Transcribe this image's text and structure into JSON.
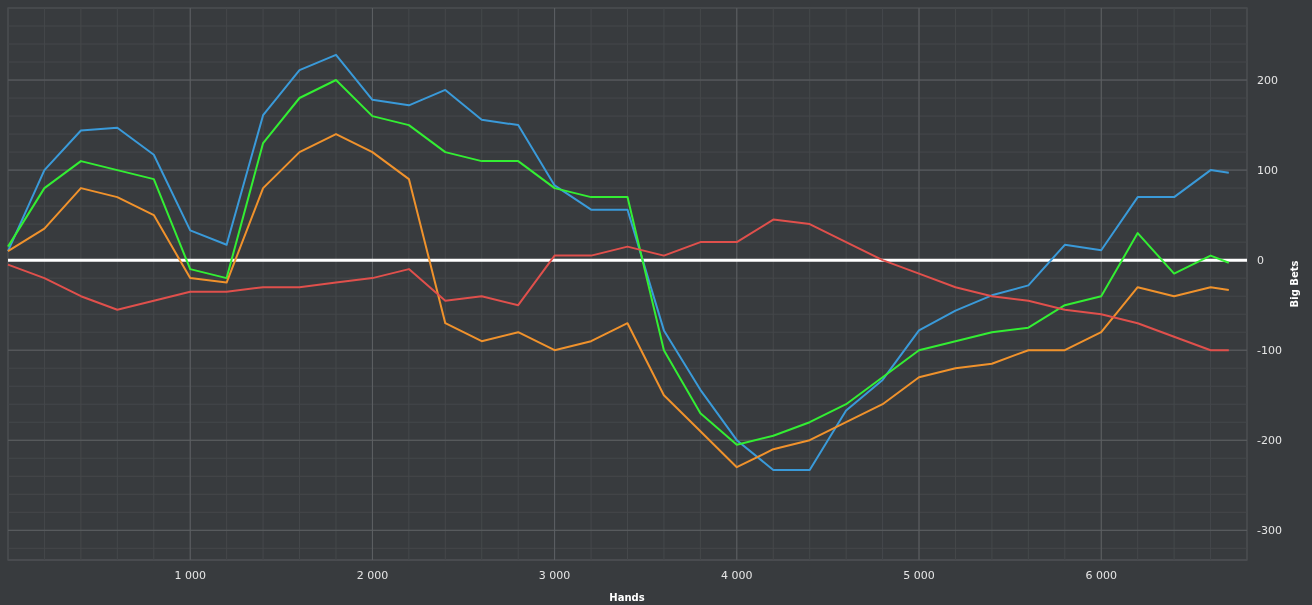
{
  "chart": {
    "chart_data": {
      "type": "line",
      "xlabel": "Hands",
      "ylabel": "Big Bets",
      "x": [
        0,
        200,
        400,
        600,
        800,
        1000,
        1200,
        1400,
        1600,
        1800,
        2000,
        2200,
        2400,
        2600,
        2800,
        3000,
        3200,
        3400,
        3600,
        3800,
        4000,
        4200,
        4400,
        4600,
        4800,
        5000,
        5200,
        5400,
        5600,
        5800,
        6000,
        6200,
        6400,
        6600,
        6700
      ],
      "series": [
        {
          "color": "#3a9ad9",
          "values": [
            10,
            100,
            144,
            147,
            117,
            33,
            17,
            161,
            211,
            228,
            178,
            172,
            189,
            156,
            150,
            83,
            56,
            56,
            -78,
            -144,
            -200,
            -233,
            -233,
            -167,
            -133,
            -78,
            -56,
            -39,
            -28,
            17,
            11,
            70,
            70,
            100,
            97
          ]
        },
        {
          "color": "#33ee33",
          "values": [
            15,
            80,
            110,
            100,
            90,
            -10,
            -20,
            130,
            180,
            200,
            160,
            150,
            120,
            110,
            110,
            80,
            70,
            70,
            -100,
            -170,
            -205,
            -195,
            -180,
            -160,
            -130,
            -100,
            -90,
            -80,
            -75,
            -50,
            -40,
            30,
            -15,
            5,
            -3
          ]
        },
        {
          "color": "#f0922c",
          "values": [
            10,
            35,
            80,
            70,
            50,
            -20,
            -25,
            80,
            120,
            140,
            120,
            90,
            -70,
            -90,
            -80,
            -100,
            -90,
            -70,
            -150,
            -190,
            -230,
            -210,
            -200,
            -180,
            -160,
            -130,
            -120,
            -115,
            -100,
            -100,
            -80,
            -30,
            -40,
            -30,
            -33
          ]
        },
        {
          "color": "#e0504c",
          "values": [
            -5,
            -20,
            -40,
            -55,
            -45,
            -35,
            -35,
            -30,
            -30,
            -25,
            -20,
            -10,
            -45,
            -40,
            -50,
            5,
            5,
            15,
            5,
            20,
            20,
            45,
            40,
            20,
            0,
            -15,
            -30,
            -40,
            -45,
            -55,
            -60,
            -70,
            -85,
            -100,
            -100
          ]
        }
      ],
      "xlim": [
        0,
        6800
      ],
      "ylim": [
        -333,
        280
      ],
      "xticks": [
        {
          "value": 1000,
          "label": "1 000"
        },
        {
          "value": 2000,
          "label": "2 000"
        },
        {
          "value": 3000,
          "label": "3 000"
        },
        {
          "value": 4000,
          "label": "4 000"
        },
        {
          "value": 5000,
          "label": "5 000"
        },
        {
          "value": 6000,
          "label": "6 000"
        }
      ],
      "yticks": [
        -300,
        -200,
        -100,
        0,
        100,
        200
      ],
      "grid": true,
      "ref_lines": [
        {
          "axis": "y",
          "value": 0
        }
      ]
    }
  }
}
